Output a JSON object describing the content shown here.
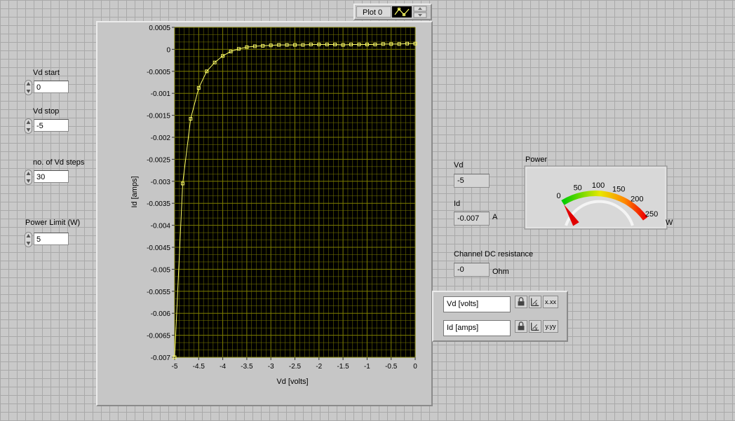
{
  "controls": {
    "vd_start": {
      "label": "Vd start",
      "value": "0"
    },
    "vd_stop": {
      "label": "Vd stop",
      "value": "-5"
    },
    "vd_steps": {
      "label": "no. of Vd steps",
      "value": "30"
    },
    "power_limit": {
      "label": "Power Limit (W)",
      "value": "5"
    }
  },
  "indicators": {
    "vd": {
      "label": "Vd",
      "value": "-5"
    },
    "id": {
      "label": "Id",
      "value": "-0.007",
      "unit": "A"
    },
    "resistance": {
      "label": "Channel DC resistance",
      "value": "-0",
      "unit": "Ohm"
    }
  },
  "plot_legend": {
    "label": "Plot 0"
  },
  "meter": {
    "label": "Power",
    "unit": "W",
    "ticks": [
      "0",
      "50",
      "100",
      "150",
      "200",
      "250"
    ],
    "value": 0.035,
    "min": 0,
    "max": 250
  },
  "scale_legend": {
    "x_name": "Vd [volts]",
    "y_name": "Id [amps]",
    "x_format_icon": "x.xx",
    "y_format_icon": "y.yy"
  },
  "colors": {
    "plot_bg": "#000000",
    "grid": "#7e7e00",
    "trace": "#ffff66"
  },
  "chart_data": {
    "type": "line",
    "xlabel": "Vd [volts]",
    "ylabel": "Id [amps]",
    "xlim": [
      -5,
      0
    ],
    "ylim": [
      -0.007,
      0.0005
    ],
    "x_ticks": [
      "-5",
      "-4.5",
      "-4",
      "-3.5",
      "-3",
      "-2.5",
      "-2",
      "-1.5",
      "-1",
      "-0.5",
      "0"
    ],
    "y_ticks": [
      "0.0005",
      "0",
      "-0.0005",
      "-0.001",
      "-0.0015",
      "-0.002",
      "-0.0025",
      "-0.003",
      "-0.0035",
      "-0.004",
      "-0.0045",
      "-0.005",
      "-0.0055",
      "-0.006",
      "-0.0065",
      "-0.007"
    ],
    "grid": true,
    "series": [
      {
        "name": "Plot 0",
        "x": [
          -5,
          -4.833,
          -4.667,
          -4.5,
          -4.333,
          -4.167,
          -4,
          -3.833,
          -3.667,
          -3.5,
          -3.333,
          -3.167,
          -3,
          -2.833,
          -2.667,
          -2.5,
          -2.333,
          -2.167,
          -2,
          -1.833,
          -1.667,
          -1.5,
          -1.333,
          -1.167,
          -1,
          -0.833,
          -0.667,
          -0.5,
          -0.333,
          -0.167,
          0
        ],
        "y": [
          -0.007,
          -0.00305,
          -0.00158,
          -0.00088,
          -0.0005,
          -0.0003,
          -0.00015,
          -5e-05,
          1e-05,
          5e-05,
          7e-05,
          8e-05,
          9e-05,
          0.0001,
          0.0001,
          0.0001,
          0.0001,
          0.00011,
          0.00011,
          0.00011,
          0.00011,
          0.0001,
          0.00011,
          0.00011,
          0.00011,
          0.00011,
          0.00012,
          0.00012,
          0.00012,
          0.00013,
          0.00013
        ]
      }
    ]
  }
}
